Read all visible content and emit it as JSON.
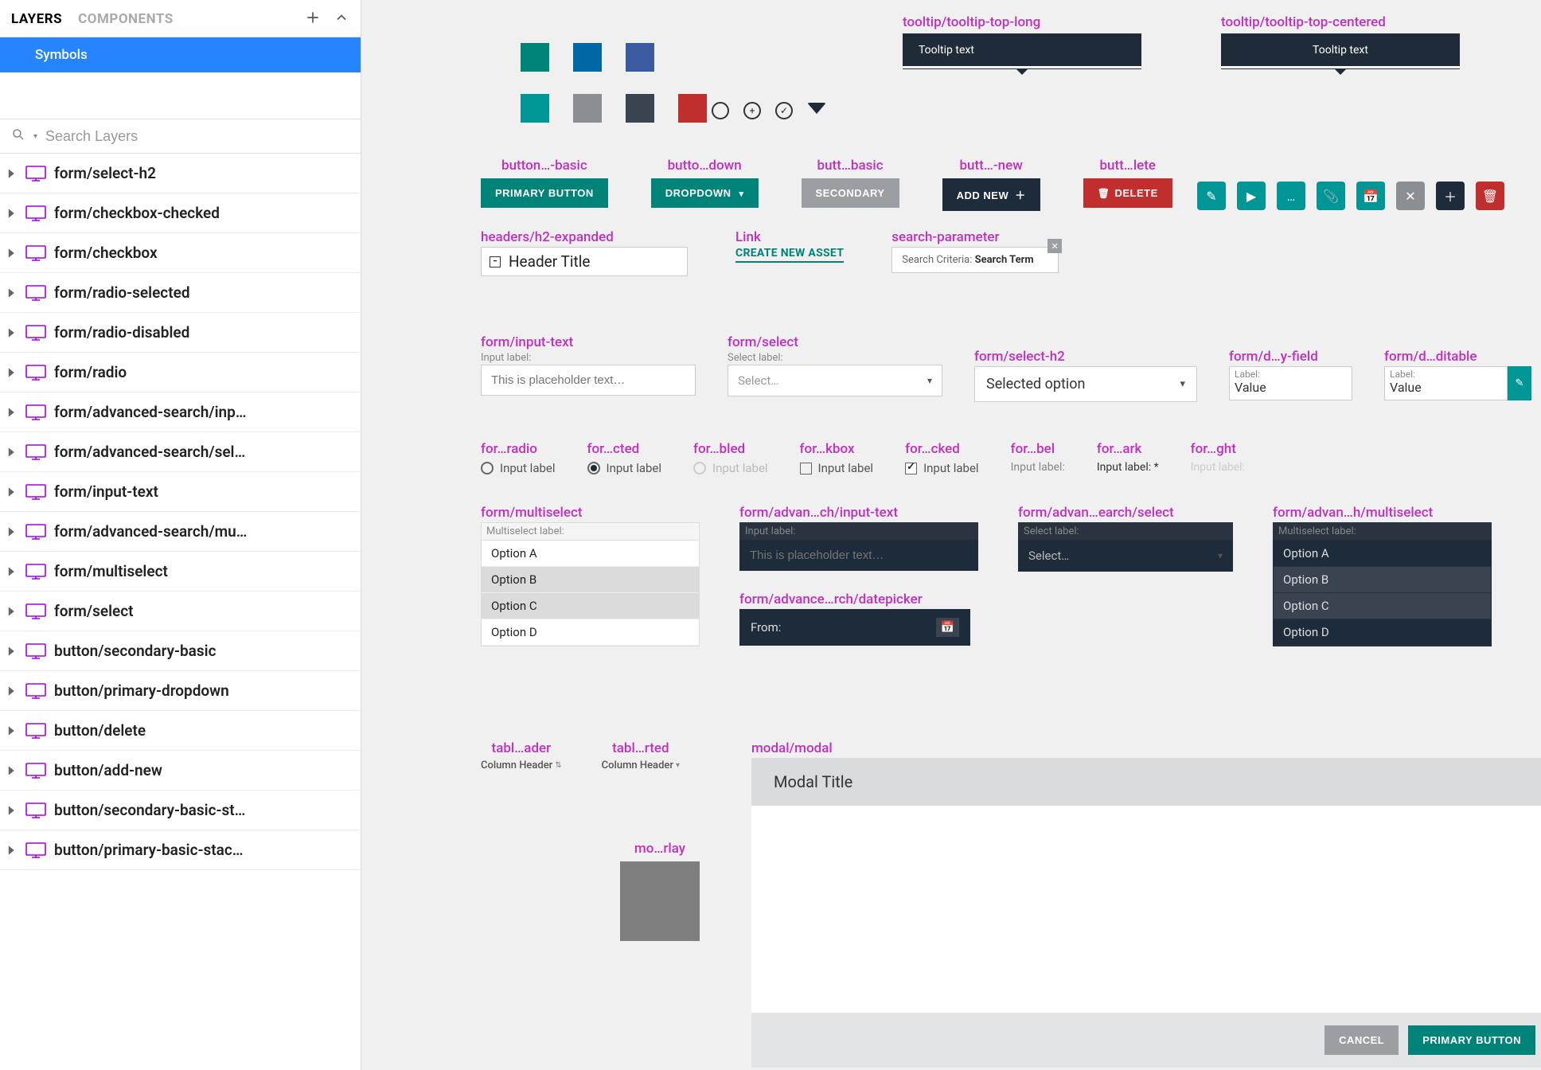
{
  "sidebar": {
    "tabs": {
      "layers": "LAYERS",
      "components": "COMPONENTS"
    },
    "root": "Symbols",
    "search_placeholder": "Search Layers",
    "layers": [
      "form/select-h2",
      "form/checkbox-checked",
      "form/checkbox",
      "form/radio-selected",
      "form/radio-disabled",
      "form/radio",
      "form/advanced-search/inp…",
      "form/advanced-search/sel…",
      "form/input-text",
      "form/advanced-search/mu…",
      "form/multiselect",
      "form/select",
      "button/secondary-basic",
      "button/primary-dropdown",
      "button/delete",
      "button/add-new",
      "button/secondary-basic-st…",
      "button/primary-basic-stac…"
    ]
  },
  "tooltips": {
    "long_label": "tooltip/tooltip-top-long",
    "long_text": "Tooltip text",
    "centered_label": "tooltip/tooltip-top-centered",
    "centered_text": "Tooltip text"
  },
  "buttons": {
    "primary_label_name": "button…-basic",
    "primary": "PRIMARY BUTTON",
    "dropdown_label_name": "butto…down",
    "dropdown": "DROPDOWN",
    "secondary_label_name": "butt…basic",
    "secondary": "SECONDARY",
    "addnew_label_name": "butt…-new",
    "addnew": "ADD NEW",
    "delete_label_name": "butt…lete",
    "delete": "DELETE"
  },
  "headers": {
    "h2_label": "headers/h2-expanded",
    "h2_text": "Header Title",
    "link_label": "Link",
    "link_text": "CREATE NEW ASSET",
    "search_label": "search-parameter",
    "search_prefix": "Search Criteria: ",
    "search_term": "Search Term"
  },
  "forms": {
    "input_text_label": "form/input-text",
    "input_field_label": "Input label:",
    "input_placeholder": "This is placeholder text…",
    "select_label": "form/select",
    "select_field_label": "Select label:",
    "select_placeholder": "Select…",
    "select_h2_label": "form/select-h2",
    "select_h2_value": "Selected option",
    "display_label": "form/d…y-field",
    "display_field_label": "Label:",
    "display_value": "Value",
    "editable_label": "form/d…ditable",
    "editable_field_label": "Label:",
    "editable_value": "Value"
  },
  "rc": {
    "radio_label": "for…radio",
    "radio_text": "Input label",
    "radio_sel_label": "for…cted",
    "radio_sel_text": "Input label",
    "radio_dis_label": "for…bled",
    "radio_dis_text": "Input label",
    "checkbox_label": "for…kbox",
    "checkbox_text": "Input label",
    "checkbox_chk_label": "for…cked",
    "checkbox_chk_text": "Input label",
    "lbl_label": "for…bel",
    "lbl_text": "Input label:",
    "lbl_dark_label": "for…ark",
    "lbl_dark_text": "Input label: *",
    "lbl_light_label": "for…ght",
    "lbl_light_text": "Input label:"
  },
  "ms": {
    "label": "form/multiselect",
    "field_label": "Multiselect label:",
    "options": [
      "Option A",
      "Option B",
      "Option C",
      "Option D"
    ],
    "adv_input_label": "form/advan…ch/input-text",
    "adv_input_field_label": "Input label:",
    "adv_input_placeholder": "This is placeholder text…",
    "adv_date_label": "form/advance…rch/datepicker",
    "adv_date_text": "From:",
    "adv_select_label": "form/advan…earch/select",
    "adv_select_field_label": "Select label:",
    "adv_select_placeholder": "Select…",
    "adv_ms_label": "form/advan…h/multiselect",
    "adv_ms_field_label": "Multiselect label:"
  },
  "table": {
    "header_label": "tabl…ader",
    "header_text": "Column Header",
    "sorted_label": "tabl…rted",
    "sorted_text": "Column Header"
  },
  "modal": {
    "label": "modal/modal",
    "title": "Modal Title",
    "cancel": "CANCEL",
    "ok": "PRIMARY BUTTON",
    "overlay_label": "mo…rlay"
  }
}
